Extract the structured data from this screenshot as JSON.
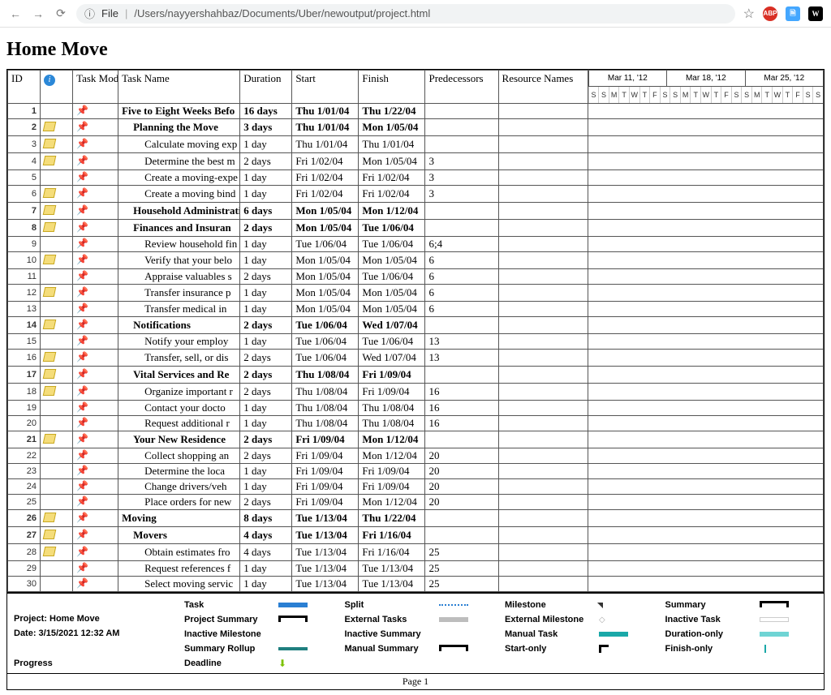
{
  "browser": {
    "url_scheme": "File",
    "url_path": "/Users/nayyershahbaz/Documents/Uber/newoutput/project.html",
    "ext": {
      "abp": "ABP",
      "tr": "⋮",
      "w": "W"
    }
  },
  "page_title": "Home Move",
  "columns": {
    "id": "ID",
    "info": "",
    "mode": "Task Mode",
    "name": "Task Name",
    "dur": "Duration",
    "start": "Start",
    "fin": "Finish",
    "pred": "Predecessors",
    "res": "Resource Names"
  },
  "timeline_weeks": [
    "Mar 11, '12",
    "Mar 18, '12",
    "Mar 25, '12"
  ],
  "timeline_days": [
    "S",
    "S",
    "M",
    "T",
    "W",
    "T",
    "F",
    "S",
    "S",
    "M",
    "T",
    "W",
    "T",
    "F",
    "S",
    "S",
    "M",
    "T",
    "W",
    "T",
    "F",
    "S",
    "S"
  ],
  "rows": [
    {
      "id": 1,
      "info": false,
      "bold": true,
      "indent": 0,
      "name": "Five to Eight Weeks Befo",
      "dur": "16 days",
      "start": "Thu 1/01/04",
      "fin": "Thu 1/22/04",
      "pred": ""
    },
    {
      "id": 2,
      "info": true,
      "bold": true,
      "indent": 1,
      "name": "Planning the Move",
      "dur": "3 days",
      "start": "Thu 1/01/04",
      "fin": "Mon 1/05/04",
      "pred": ""
    },
    {
      "id": 3,
      "info": true,
      "bold": false,
      "indent": 2,
      "name": "Calculate moving exp",
      "dur": "1 day",
      "start": "Thu 1/01/04",
      "fin": "Thu 1/01/04",
      "pred": ""
    },
    {
      "id": 4,
      "info": true,
      "bold": false,
      "indent": 2,
      "name": "Determine the best m",
      "dur": "2 days",
      "start": "Fri 1/02/04",
      "fin": "Mon 1/05/04",
      "pred": "3"
    },
    {
      "id": 5,
      "info": false,
      "bold": false,
      "indent": 2,
      "name": "Create a moving-expe",
      "dur": "1 day",
      "start": "Fri 1/02/04",
      "fin": "Fri 1/02/04",
      "pred": "3"
    },
    {
      "id": 6,
      "info": true,
      "bold": false,
      "indent": 2,
      "name": "Create a moving bind",
      "dur": "1 day",
      "start": "Fri 1/02/04",
      "fin": "Fri 1/02/04",
      "pred": "3"
    },
    {
      "id": 7,
      "info": true,
      "bold": true,
      "indent": 1,
      "name": "Household Administrati",
      "dur": "6 days",
      "start": "Mon 1/05/04",
      "fin": "Mon 1/12/04",
      "pred": ""
    },
    {
      "id": 8,
      "info": true,
      "bold": true,
      "indent": 1,
      "name": "Finances and Insuran",
      "dur": "2 days",
      "start": "Mon 1/05/04",
      "fin": "Tue 1/06/04",
      "pred": ""
    },
    {
      "id": 9,
      "info": false,
      "bold": false,
      "indent": 2,
      "name": "Review household fin",
      "dur": "1 day",
      "start": "Tue 1/06/04",
      "fin": "Tue 1/06/04",
      "pred": "6;4"
    },
    {
      "id": 10,
      "info": true,
      "bold": false,
      "indent": 2,
      "name": "Verify that your belo",
      "dur": "1 day",
      "start": "Mon 1/05/04",
      "fin": "Mon 1/05/04",
      "pred": "6"
    },
    {
      "id": 11,
      "info": false,
      "bold": false,
      "indent": 2,
      "name": "Appraise valuables s",
      "dur": "2 days",
      "start": "Mon 1/05/04",
      "fin": "Tue 1/06/04",
      "pred": "6"
    },
    {
      "id": 12,
      "info": true,
      "bold": false,
      "indent": 2,
      "name": "Transfer insurance p",
      "dur": "1 day",
      "start": "Mon 1/05/04",
      "fin": "Mon 1/05/04",
      "pred": "6"
    },
    {
      "id": 13,
      "info": false,
      "bold": false,
      "indent": 2,
      "name": "Transfer medical in",
      "dur": "1 day",
      "start": "Mon 1/05/04",
      "fin": "Mon 1/05/04",
      "pred": "6"
    },
    {
      "id": 14,
      "info": true,
      "bold": true,
      "indent": 1,
      "name": "Notifications",
      "dur": "2 days",
      "start": "Tue 1/06/04",
      "fin": "Wed 1/07/04",
      "pred": ""
    },
    {
      "id": 15,
      "info": false,
      "bold": false,
      "indent": 2,
      "name": "Notify your employ",
      "dur": "1 day",
      "start": "Tue 1/06/04",
      "fin": "Tue 1/06/04",
      "pred": "13"
    },
    {
      "id": 16,
      "info": true,
      "bold": false,
      "indent": 2,
      "name": "Transfer, sell, or dis",
      "dur": "2 days",
      "start": "Tue 1/06/04",
      "fin": "Wed 1/07/04",
      "pred": "13"
    },
    {
      "id": 17,
      "info": true,
      "bold": true,
      "indent": 1,
      "name": "Vital Services and Re",
      "dur": "2 days",
      "start": "Thu 1/08/04",
      "fin": "Fri 1/09/04",
      "pred": ""
    },
    {
      "id": 18,
      "info": true,
      "bold": false,
      "indent": 2,
      "name": "Organize important r",
      "dur": "2 days",
      "start": "Thu 1/08/04",
      "fin": "Fri 1/09/04",
      "pred": "16"
    },
    {
      "id": 19,
      "info": false,
      "bold": false,
      "indent": 2,
      "name": "Contact your docto",
      "dur": "1 day",
      "start": "Thu 1/08/04",
      "fin": "Thu 1/08/04",
      "pred": "16"
    },
    {
      "id": 20,
      "info": false,
      "bold": false,
      "indent": 2,
      "name": "Request additional r",
      "dur": "1 day",
      "start": "Thu 1/08/04",
      "fin": "Thu 1/08/04",
      "pred": "16"
    },
    {
      "id": 21,
      "info": true,
      "bold": true,
      "indent": 1,
      "name": "Your New Residence",
      "dur": "2 days",
      "start": "Fri 1/09/04",
      "fin": "Mon 1/12/04",
      "pred": ""
    },
    {
      "id": 22,
      "info": false,
      "bold": false,
      "indent": 2,
      "name": "Collect shopping an",
      "dur": "2 days",
      "start": "Fri 1/09/04",
      "fin": "Mon 1/12/04",
      "pred": "20"
    },
    {
      "id": 23,
      "info": false,
      "bold": false,
      "indent": 2,
      "name": "Determine the loca",
      "dur": "1 day",
      "start": "Fri 1/09/04",
      "fin": "Fri 1/09/04",
      "pred": "20"
    },
    {
      "id": 24,
      "info": false,
      "bold": false,
      "indent": 2,
      "name": "Change drivers/veh",
      "dur": "1 day",
      "start": "Fri 1/09/04",
      "fin": "Fri 1/09/04",
      "pred": "20"
    },
    {
      "id": 25,
      "info": false,
      "bold": false,
      "indent": 2,
      "name": "Place orders for new",
      "dur": "2 days",
      "start": "Fri 1/09/04",
      "fin": "Mon 1/12/04",
      "pred": "20"
    },
    {
      "id": 26,
      "info": true,
      "bold": true,
      "indent": 0,
      "name": "Moving",
      "dur": "8 days",
      "start": "Tue 1/13/04",
      "fin": "Thu 1/22/04",
      "pred": ""
    },
    {
      "id": 27,
      "info": true,
      "bold": true,
      "indent": 1,
      "name": "Movers",
      "dur": "4 days",
      "start": "Tue 1/13/04",
      "fin": "Fri 1/16/04",
      "pred": ""
    },
    {
      "id": 28,
      "info": true,
      "bold": false,
      "indent": 2,
      "name": "Obtain estimates fro",
      "dur": "4 days",
      "start": "Tue 1/13/04",
      "fin": "Fri 1/16/04",
      "pred": "25"
    },
    {
      "id": 29,
      "info": false,
      "bold": false,
      "indent": 2,
      "name": "Request references f",
      "dur": "1 day",
      "start": "Tue 1/13/04",
      "fin": "Tue 1/13/04",
      "pred": "25"
    },
    {
      "id": 30,
      "info": false,
      "bold": false,
      "indent": 2,
      "name": "Select moving servic",
      "dur": "1 day",
      "start": "Tue 1/13/04",
      "fin": "Tue 1/13/04",
      "pred": "25"
    }
  ],
  "legend": {
    "project_label": "Project: Home Move",
    "date_label": "Date: 3/15/2021 12:32 AM",
    "items": {
      "task": "Task",
      "ext": "External Tasks",
      "man": "Manual Task",
      "fin": "Finish-only",
      "split": "Split",
      "extm": "External Milestone",
      "dur": "Duration-only",
      "prog": "Progress",
      "mile": "Milestone",
      "inact": "Inactive Task",
      "roll": "Summary Rollup",
      "dead": "Deadline",
      "sum": "Summary",
      "imile": "Inactive Milestone",
      "msum": "Manual Summary",
      "psum": "Project Summary",
      "isum": "Inactive Summary",
      "start": "Start-only"
    }
  },
  "footer": "Page 1"
}
